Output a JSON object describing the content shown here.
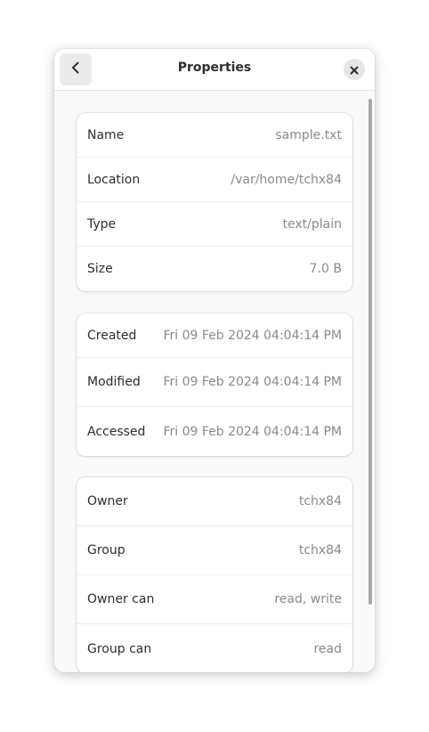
{
  "window": {
    "title": "Properties"
  },
  "icons": {
    "back": "go-back-icon",
    "close": "close-icon"
  },
  "file_info": [
    {
      "label": "Name",
      "value": "sample.txt"
    },
    {
      "label": "Location",
      "value": "/var/home/tchx84"
    },
    {
      "label": "Type",
      "value": "text/plain"
    },
    {
      "label": "Size",
      "value": "7.0 B"
    }
  ],
  "timestamps": [
    {
      "label": "Created",
      "value": "Fri 09 Feb 2024 04:04:14 PM"
    },
    {
      "label": "Modified",
      "value": "Fri 09 Feb 2024 04:04:14 PM"
    },
    {
      "label": "Accessed",
      "value": "Fri 09 Feb 2024 04:04:14 PM"
    }
  ],
  "permissions": [
    {
      "label": "Owner",
      "value": "tchx84"
    },
    {
      "label": "Group",
      "value": "tchx84"
    },
    {
      "label": "Owner can",
      "value": "read, write"
    },
    {
      "label": "Group can",
      "value": "read"
    }
  ]
}
